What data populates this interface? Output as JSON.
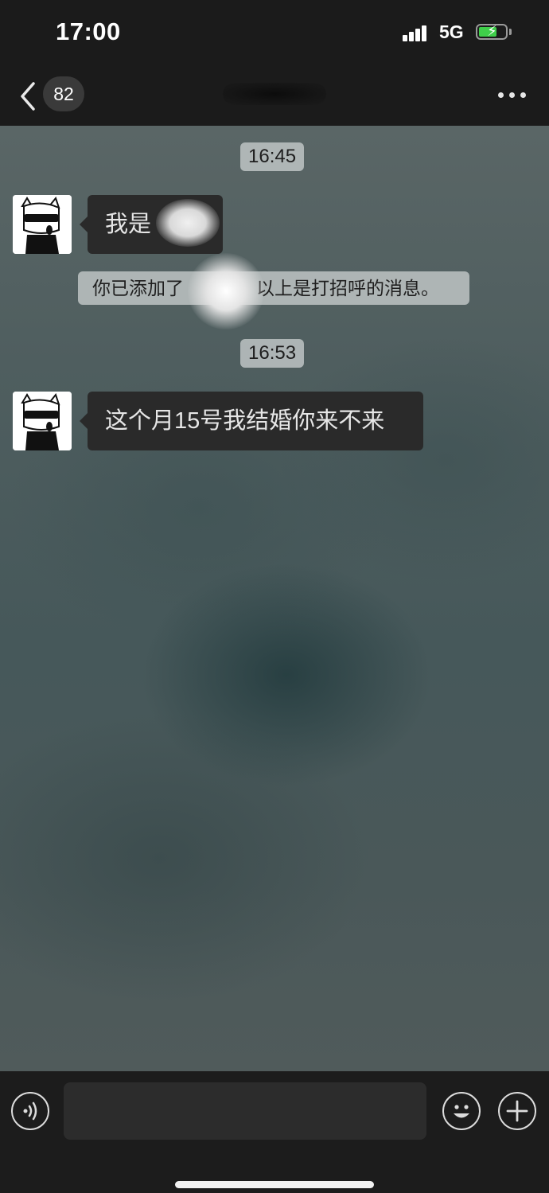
{
  "status_bar": {
    "time": "17:00",
    "network": "5G",
    "battery_icon": "battery-charging-icon",
    "battery_color": "#3fcf4a"
  },
  "nav": {
    "back_icon": "chevron-left-icon",
    "unread_count": "82",
    "more_icon": "more-dots-icon"
  },
  "messages": [
    {
      "kind": "timestamp",
      "text": "16:45"
    },
    {
      "kind": "incoming",
      "text": "我是"
    },
    {
      "kind": "system",
      "text_left": "你已添加了",
      "text_right": "以上是打招呼的消息。"
    },
    {
      "kind": "timestamp",
      "text": "16:53"
    },
    {
      "kind": "incoming",
      "text": "这个月15号我结婚你来不来"
    }
  ],
  "input_bar": {
    "voice_icon": "voice-icon",
    "input_value": "",
    "emoji_icon": "emoji-icon",
    "add_icon": "plus-icon"
  }
}
